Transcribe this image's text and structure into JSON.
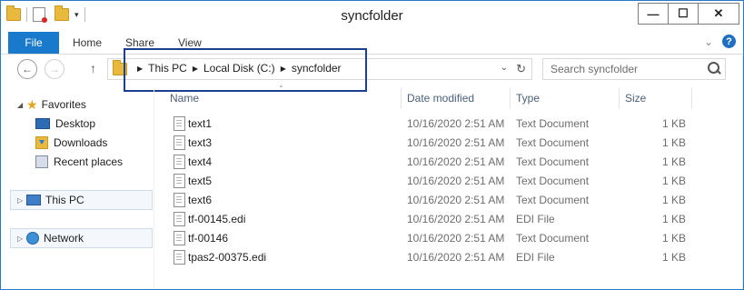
{
  "window": {
    "title": "syncfolder",
    "buttons": {
      "minimize": "—",
      "maximize": "☐",
      "close": "✕"
    }
  },
  "ribbon": {
    "tabs": [
      "File",
      "Home",
      "Share",
      "View"
    ],
    "help": "?"
  },
  "address": {
    "crumbs": [
      "This PC",
      "Local Disk (C:)",
      "syncfolder"
    ]
  },
  "search": {
    "placeholder": "Search syncfolder"
  },
  "nav": {
    "favorites": "Favorites",
    "favorites_items": [
      "Desktop",
      "Downloads",
      "Recent places"
    ],
    "this_pc": "This PC",
    "network": "Network"
  },
  "columns": {
    "name": "Name",
    "date": "Date modified",
    "type": "Type",
    "size": "Size"
  },
  "files": [
    {
      "name": "text1",
      "date": "10/16/2020 2:51 AM",
      "type": "Text Document",
      "size": "1 KB"
    },
    {
      "name": "text3",
      "date": "10/16/2020 2:51 AM",
      "type": "Text Document",
      "size": "1 KB"
    },
    {
      "name": "text4",
      "date": "10/16/2020 2:51 AM",
      "type": "Text Document",
      "size": "1 KB"
    },
    {
      "name": "text5",
      "date": "10/16/2020 2:51 AM",
      "type": "Text Document",
      "size": "1 KB"
    },
    {
      "name": "text6",
      "date": "10/16/2020 2:51 AM",
      "type": "Text Document",
      "size": "1 KB"
    },
    {
      "name": "tf-00145.edi",
      "date": "10/16/2020 2:51 AM",
      "type": "EDI File",
      "size": "1 KB"
    },
    {
      "name": "tf-00146",
      "date": "10/16/2020 2:51 AM",
      "type": "Text Document",
      "size": "1 KB"
    },
    {
      "name": "tpas2-00375.edi",
      "date": "10/16/2020 2:51 AM",
      "type": "EDI File",
      "size": "1 KB"
    }
  ]
}
